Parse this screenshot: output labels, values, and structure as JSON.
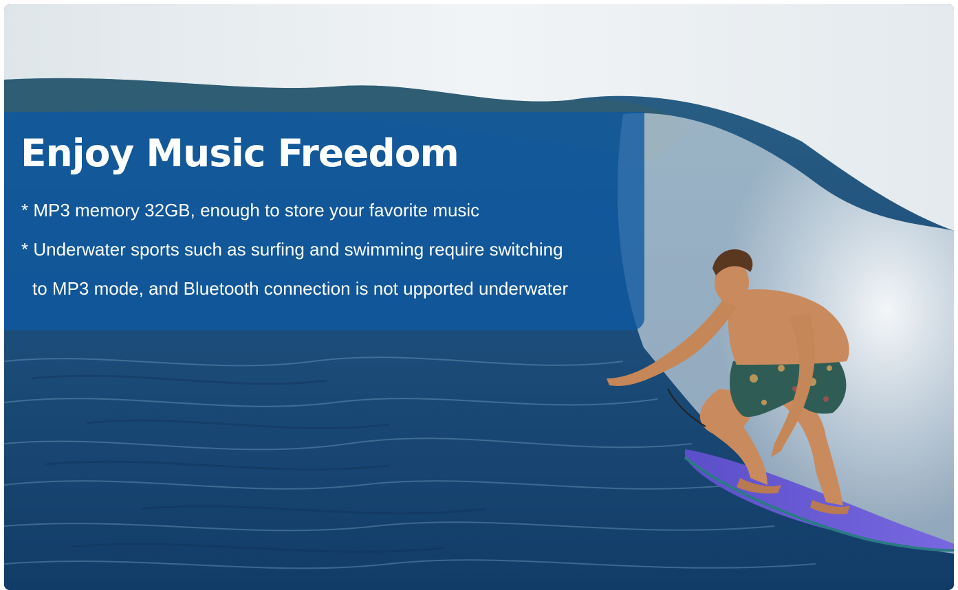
{
  "banner": {
    "title": "Enjoy Music Freedom",
    "bullets": [
      "* MP3 memory 32GB, enough to store your favorite music",
      "* Underwater sports such as surfing and swimming require switching",
      "to MP3 mode, and Bluetooth connection is not upported underwater"
    ],
    "background_color": "#0e58a0"
  },
  "scene": {
    "subject": "surfer riding a breaking ocean wave on a purple surfboard",
    "colors": {
      "ocean": "#1d4f7e",
      "spray": "#e8eef2",
      "surfboard": "#6a5acd",
      "skin": "#c98a5e",
      "shorts": "#2f5d55"
    }
  }
}
